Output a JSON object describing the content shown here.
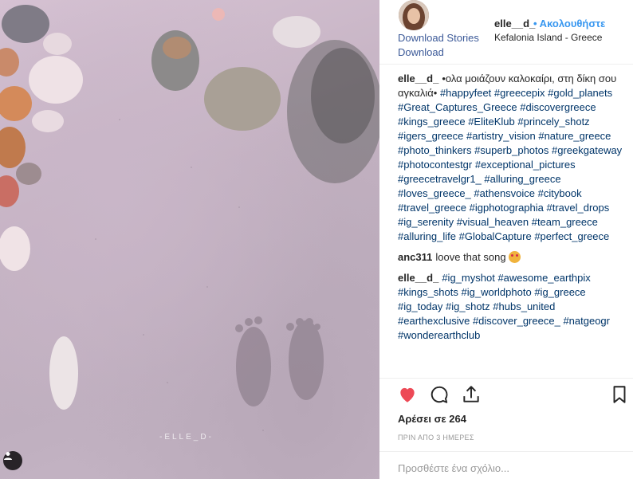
{
  "post": {
    "username": "elle__d_",
    "follow_label": "• Ακολουθήστε",
    "location": "Kefalonia Island - Greece",
    "download_stories": "Download Stories",
    "download": "Download",
    "watermark": "-ELLE_D-"
  },
  "comments": [
    {
      "user": "elle__d_",
      "text": "•ολα μοιάζουν καλοκαίρι, στη δίκη σου αγκαλιά•",
      "tags": [
        "#happyfeet",
        "#greecepix",
        "#gold_planets",
        "#Great_Captures_Greece",
        "#discovergreece",
        "#kings_greece",
        "#EliteKlub",
        "#princely_shotz",
        "#igers_greece",
        "#artistry_vision",
        "#nature_greece",
        "#photo_thinkers",
        "#superb_photos",
        "#greekgateway",
        "#photocontestgr",
        "#exceptional_pictures",
        "#greecetravelgr1_",
        "#alluring_greece",
        "#loves_greece_",
        "#athensvoice",
        "#citybook",
        "#travel_greece",
        "#igphotographia",
        "#travel_drops",
        "#ig_serenity",
        "#visual_heaven",
        "#team_greece",
        "#alluring_life",
        "#GlobalCapture",
        "#perfect_greece"
      ]
    },
    {
      "user": "anc311",
      "text": "loove that song",
      "tags": [],
      "emoji": "star-struck-emoji"
    },
    {
      "user": "elle__d_",
      "text": "",
      "tags": [
        "#ig_myshot",
        "#awesome_earthpix",
        "#kings_shots",
        "#ig_worldphoto",
        "#ig_greece",
        "#ig_today",
        "#ig_shotz",
        "#hubs_united",
        "#earthexclusive",
        "#discover_greece_",
        "#natgeogr",
        "#wonderearthclub"
      ]
    }
  ],
  "likes": "Αρέσει σε 264",
  "time": "ΠΡΙΝ ΑΠΟ 3 ΗΜΕΡΕΣ",
  "add_comment_placeholder": "Προσθέστε ένα σχόλιο...",
  "icons": [
    "heart-icon",
    "comment-icon",
    "share-icon",
    "bookmark-icon",
    "user-tag-icon"
  ],
  "colors": {
    "link": "#3b5998",
    "follow": "#3897f0",
    "hashtag": "#003569",
    "like": "#ed4956"
  }
}
